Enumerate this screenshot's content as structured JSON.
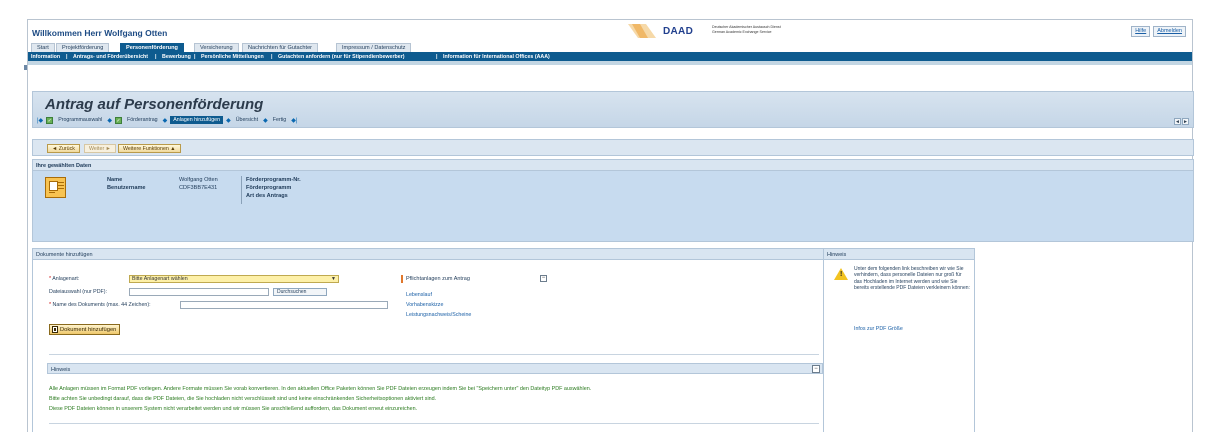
{
  "header": {
    "welcome": "Willkommen Herr Wolfgang Otten",
    "logo_text": "DAAD",
    "logo_sub1": "Deutscher Akademischer Austausch Dienst",
    "logo_sub2": "German Academic Exchange Service",
    "links": [
      "Hilfe",
      "Abmelden"
    ]
  },
  "tabs": [
    {
      "label": "Start"
    },
    {
      "label": "Projektförderung"
    },
    {
      "label": "Personenförderung"
    },
    {
      "label": "Versicherung"
    },
    {
      "label": "Nachrichten für Gutachter"
    },
    {
      "label": "Impressum / Datenschutz"
    }
  ],
  "subnav": [
    "Information",
    "|",
    "Antrags- und Förderübersicht",
    "|",
    "Bewerbung",
    "|",
    "Persönliche Mitteilungen",
    "|",
    "Gutachten anfordern (nur für Stipendienbewerber)",
    "|",
    "Information für International Offices (AAA)"
  ],
  "page": {
    "title": "Antrag auf Personenförderung",
    "roadmap": [
      "Programmauswahl",
      "Förderantrag",
      "Anlagen hinzufügen",
      "Übersicht",
      "Fertig"
    ]
  },
  "toolbar": {
    "back": "◄ Zurück",
    "next": "Weiter ►",
    "more": "Weitere Funktionen ▲"
  },
  "data_panel": {
    "title": "Ihre gewählten Daten",
    "name_label": "Name",
    "name_value": "Wolfgang Otten",
    "user_label": "Benutzername",
    "user_value": "CDF3BB7E431",
    "prog_nr_label": "Förderprogramm-Nr.",
    "prog_label": "Förderprogramm",
    "type_label": "Art des Antrags"
  },
  "upload": {
    "title": "Dokumente hinzufügen",
    "anlagenart_label": "Anlagenart:",
    "anlagenart_value": "Bitte Anlagenart wählen",
    "datei_label": "Dateiauswahl (nur PDF):",
    "browse_label": "Durchsuchen",
    "name_label": "Name des Dokuments (max. 44 Zeichen):",
    "add_button": "Dokument hinzufügen",
    "pflicht_title": "Pflichtanlagen zum Antrag",
    "pflicht_links": [
      "Lebenslauf",
      "Vorhabenskizze",
      "Leistungsnachweis/Scheine"
    ],
    "hint_title": "Hinweis",
    "hint_lines": [
      "Alle Anlagen müssen im Format PDF vorliegen. Andere Formate müssen Sie vorab konvertieren. In den aktuellen Office Paketen können Sie PDF Dateien erzeugen indem Sie bei \"Speichern unter\" den Dateityp PDF auswählen.",
      "Bitte achten Sie unbedingt darauf, dass die PDF Dateien, die Sie hochladen nicht verschlüsselt sind und keine einschränkenden Sicherheitsoptionen aktiviert sind.",
      "Diese PDF Dateien können in unserem System nicht verarbeitet werden und wir müssen Sie anschließend auffordern, das Dokument erneut einzureichen."
    ]
  },
  "notice": {
    "title": "Hinweis",
    "text": "Unter dem folgenden link beschreiben wir wie Sie verhindern, dass personelle Dateien nur groß für das Hochladen im Internet werden und wie Sie bereits erstellende PDF Dateien verkleinern können:",
    "link": "Infos zur PDF Größe"
  },
  "colors": {
    "brand_blue": "#0e5b8f",
    "hint_green": "#2a7a1e",
    "highlight_yellow": "#fdf0a8"
  }
}
